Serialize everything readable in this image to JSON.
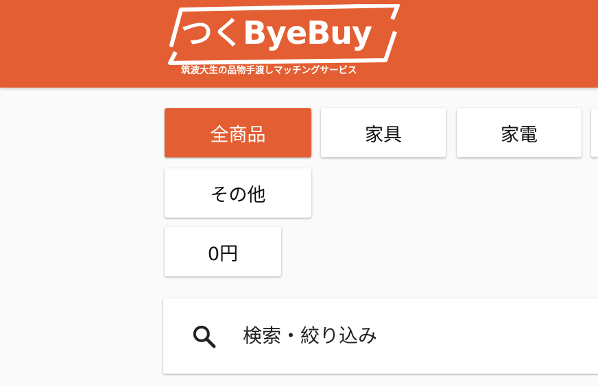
{
  "header": {
    "logo_text": "つくByeBuy",
    "tagline": "筑波大生の品物手渡しマッチングサービス",
    "bg_color": "#e35f33"
  },
  "categories": {
    "items": [
      {
        "label": "全商品",
        "active": true
      },
      {
        "label": "家具",
        "active": false
      },
      {
        "label": "家電",
        "active": false
      },
      {
        "label": "その他",
        "active": false
      }
    ],
    "accent_color": "#e35f33"
  },
  "price_filter": {
    "label": "0円"
  },
  "search": {
    "placeholder": "検索・絞り込み",
    "icon": "search-icon"
  }
}
